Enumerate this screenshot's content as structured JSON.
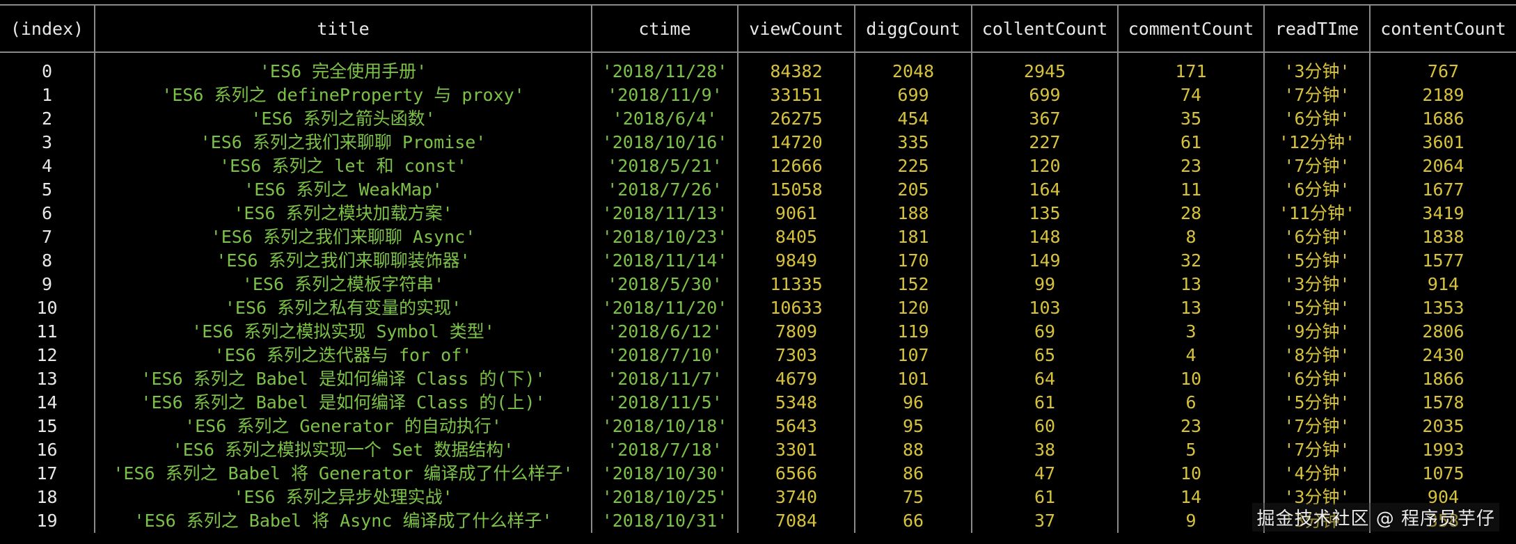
{
  "table": {
    "headers": [
      "(index)",
      "title",
      "ctime",
      "viewCount",
      "diggCount",
      "collentCount",
      "commentCount",
      "readTIme",
      "contentCount"
    ],
    "rows": [
      {
        "index": "0",
        "title": "'ES6 完全使用手册'",
        "ctime": "'2018/11/28'",
        "viewCount": "84382",
        "diggCount": "2048",
        "collentCount": "2945",
        "commentCount": "171",
        "readTIme": "'3分钟'",
        "contentCount": "767"
      },
      {
        "index": "1",
        "title": "'ES6 系列之 defineProperty 与 proxy'",
        "ctime": "'2018/11/9'",
        "viewCount": "33151",
        "diggCount": "699",
        "collentCount": "699",
        "commentCount": "74",
        "readTIme": "'7分钟'",
        "contentCount": "2189"
      },
      {
        "index": "2",
        "title": "'ES6 系列之箭头函数'",
        "ctime": "'2018/6/4'",
        "viewCount": "26275",
        "diggCount": "454",
        "collentCount": "367",
        "commentCount": "35",
        "readTIme": "'6分钟'",
        "contentCount": "1686"
      },
      {
        "index": "3",
        "title": "'ES6 系列之我们来聊聊 Promise'",
        "ctime": "'2018/10/16'",
        "viewCount": "14720",
        "diggCount": "335",
        "collentCount": "227",
        "commentCount": "61",
        "readTIme": "'12分钟'",
        "contentCount": "3601"
      },
      {
        "index": "4",
        "title": "'ES6 系列之 let 和 const'",
        "ctime": "'2018/5/21'",
        "viewCount": "12666",
        "diggCount": "225",
        "collentCount": "120",
        "commentCount": "23",
        "readTIme": "'7分钟'",
        "contentCount": "2064"
      },
      {
        "index": "5",
        "title": "'ES6 系列之 WeakMap'",
        "ctime": "'2018/7/26'",
        "viewCount": "15058",
        "diggCount": "205",
        "collentCount": "164",
        "commentCount": "11",
        "readTIme": "'6分钟'",
        "contentCount": "1677"
      },
      {
        "index": "6",
        "title": "'ES6 系列之模块加载方案'",
        "ctime": "'2018/11/13'",
        "viewCount": "9061",
        "diggCount": "188",
        "collentCount": "135",
        "commentCount": "28",
        "readTIme": "'11分钟'",
        "contentCount": "3419"
      },
      {
        "index": "7",
        "title": "'ES6 系列之我们来聊聊 Async'",
        "ctime": "'2018/10/23'",
        "viewCount": "8405",
        "diggCount": "181",
        "collentCount": "148",
        "commentCount": "8",
        "readTIme": "'6分钟'",
        "contentCount": "1838"
      },
      {
        "index": "8",
        "title": "'ES6 系列之我们来聊聊装饰器'",
        "ctime": "'2018/11/14'",
        "viewCount": "9849",
        "diggCount": "170",
        "collentCount": "149",
        "commentCount": "32",
        "readTIme": "'5分钟'",
        "contentCount": "1577"
      },
      {
        "index": "9",
        "title": "'ES6 系列之模板字符串'",
        "ctime": "'2018/5/30'",
        "viewCount": "11335",
        "diggCount": "152",
        "collentCount": "99",
        "commentCount": "13",
        "readTIme": "'3分钟'",
        "contentCount": "914"
      },
      {
        "index": "10",
        "title": "'ES6 系列之私有变量的实现'",
        "ctime": "'2018/11/20'",
        "viewCount": "10633",
        "diggCount": "120",
        "collentCount": "103",
        "commentCount": "13",
        "readTIme": "'5分钟'",
        "contentCount": "1353"
      },
      {
        "index": "11",
        "title": "'ES6 系列之模拟实现 Symbol 类型'",
        "ctime": "'2018/6/12'",
        "viewCount": "7809",
        "diggCount": "119",
        "collentCount": "69",
        "commentCount": "3",
        "readTIme": "'9分钟'",
        "contentCount": "2806"
      },
      {
        "index": "12",
        "title": "'ES6 系列之迭代器与 for of'",
        "ctime": "'2018/7/10'",
        "viewCount": "7303",
        "diggCount": "107",
        "collentCount": "65",
        "commentCount": "4",
        "readTIme": "'8分钟'",
        "contentCount": "2430"
      },
      {
        "index": "13",
        "title": "'ES6 系列之 Babel 是如何编译 Class 的(下)'",
        "ctime": "'2018/11/7'",
        "viewCount": "4679",
        "diggCount": "101",
        "collentCount": "64",
        "commentCount": "10",
        "readTIme": "'6分钟'",
        "contentCount": "1866"
      },
      {
        "index": "14",
        "title": "'ES6 系列之 Babel 是如何编译 Class 的(上)'",
        "ctime": "'2018/11/5'",
        "viewCount": "5348",
        "diggCount": "96",
        "collentCount": "61",
        "commentCount": "6",
        "readTIme": "'5分钟'",
        "contentCount": "1578"
      },
      {
        "index": "15",
        "title": "'ES6 系列之 Generator 的自动执行'",
        "ctime": "'2018/10/18'",
        "viewCount": "5643",
        "diggCount": "95",
        "collentCount": "60",
        "commentCount": "23",
        "readTIme": "'7分钟'",
        "contentCount": "2035"
      },
      {
        "index": "16",
        "title": "'ES6 系列之模拟实现一个 Set 数据结构'",
        "ctime": "'2018/7/18'",
        "viewCount": "3301",
        "diggCount": "88",
        "collentCount": "38",
        "commentCount": "5",
        "readTIme": "'7分钟'",
        "contentCount": "1993"
      },
      {
        "index": "17",
        "title": "'ES6 系列之 Babel 将 Generator 编译成了什么样子'",
        "ctime": "'2018/10/30'",
        "viewCount": "6566",
        "diggCount": "86",
        "collentCount": "47",
        "commentCount": "10",
        "readTIme": "'4分钟'",
        "contentCount": "1075"
      },
      {
        "index": "18",
        "title": "'ES6 系列之异步处理实战'",
        "ctime": "'2018/10/25'",
        "viewCount": "3740",
        "diggCount": "75",
        "collentCount": "61",
        "commentCount": "14",
        "readTIme": "'3分钟'",
        "contentCount": "904"
      },
      {
        "index": "19",
        "title": "'ES6 系列之 Babel 将 Async 编译成了什么样子'",
        "ctime": "'2018/10/31'",
        "viewCount": "7084",
        "diggCount": "66",
        "collentCount": "37",
        "commentCount": "9",
        "readTIme": "'3分钟'",
        "contentCount": "358"
      }
    ]
  },
  "watermark": "掘金技术社区 @ 程序员芋仔",
  "colors": {
    "background": "#000000",
    "header_text": "#e8e8e8",
    "string_value": "#7bc247",
    "number_value": "#d7c23c",
    "border": "#8a8a8a"
  }
}
